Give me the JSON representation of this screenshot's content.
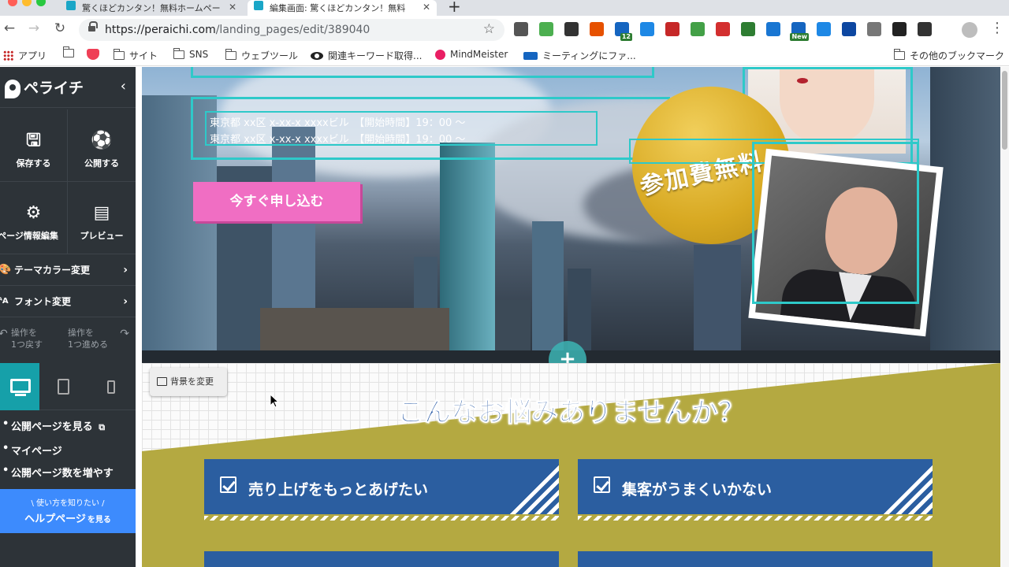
{
  "browser": {
    "tabs": [
      {
        "title": "驚くほどカンタン！無料ホームペー"
      },
      {
        "title": "編集画面: 驚くほどカンタン！無料"
      }
    ],
    "new_tab": "+",
    "url_host": "https://peraichi.com",
    "url_path": "/landing_pages/edit/389040",
    "extensions": [
      {
        "icon": "eyedropper-icon",
        "color": "#555555"
      },
      {
        "icon": "colorzilla-icon",
        "color": "#4caf50"
      },
      {
        "icon": "recycle-icon",
        "color": "#333333"
      },
      {
        "icon": "honey-icon",
        "color": "#e65100"
      },
      {
        "icon": "code-icon",
        "color": "#1565c0",
        "badge": "12"
      },
      {
        "icon": "page-icon",
        "color": "#1e88e5"
      },
      {
        "icon": "dots-icon",
        "color": "#c62828"
      },
      {
        "icon": "evernote-icon",
        "color": "#43a047"
      },
      {
        "icon": "calendar-icon",
        "color": "#d32f2f"
      },
      {
        "icon": "refresh-icon",
        "color": "#2e7d32"
      },
      {
        "icon": "bi-icon",
        "color": "#1976d2"
      },
      {
        "icon": "new-icon",
        "color": "#1565c0",
        "badge": "New"
      },
      {
        "icon": "download-icon",
        "color": "#1e88e5"
      },
      {
        "icon": "v-icon",
        "color": "#0d47a1"
      },
      {
        "icon": "tinymce-icon",
        "color": "#777777"
      },
      {
        "icon": "bw-icon",
        "color": "#222222"
      },
      {
        "icon": "pocket-icon",
        "color": "#333333"
      }
    ],
    "bookmarks": [
      "アプリ",
      "",
      "サイト",
      "SNS",
      "ウェブツール",
      "関連キーワード取得...",
      "MindMeister",
      "ミーティングにファ...",
      "その他のブックマーク"
    ]
  },
  "sidebar": {
    "logo": "ペライチ",
    "tiles": [
      {
        "label": "保存する"
      },
      {
        "label": "公開する"
      },
      {
        "label": "ページ情報編集"
      },
      {
        "label": "プレビュー"
      }
    ],
    "rows": [
      {
        "label": "テーマカラー変更"
      },
      {
        "label": "フォント変更"
      }
    ],
    "undo": {
      "line1": "操作を",
      "line2": "1つ戻す"
    },
    "redo": {
      "line1": "操作を",
      "line2": "1つ進める"
    },
    "links": [
      "公開ページを見る",
      "マイページ",
      "公開ページ数を増やす"
    ],
    "help": {
      "sub": "\\ 使い方を知りたい /",
      "main": "ヘルプページ",
      "suffix": "を見る"
    }
  },
  "hero": {
    "info_lines": [
      "東京都 xx区 x-xx-x xxxxビル　【開始時間】19：00 ～",
      "東京都 xx区 x-xx-x xxxxビル　【開始時間】19：00 ～"
    ],
    "cta": "今すぐ申し込む",
    "medal": "参加費無料"
  },
  "section2": {
    "bg_button": "背景を変更",
    "title": "こんなお悩みありませんか？",
    "cards": [
      "売り上げをもっとあげたい",
      "集客がうまくいかない"
    ]
  },
  "colors": {
    "sidebar_bg": "#2d3338",
    "accent_teal": "#16a0a9",
    "cta_pink": "#f06ec3",
    "olive": "#b4a941",
    "card_blue": "#2b5ea0",
    "help_blue": "#3d8bfd"
  }
}
